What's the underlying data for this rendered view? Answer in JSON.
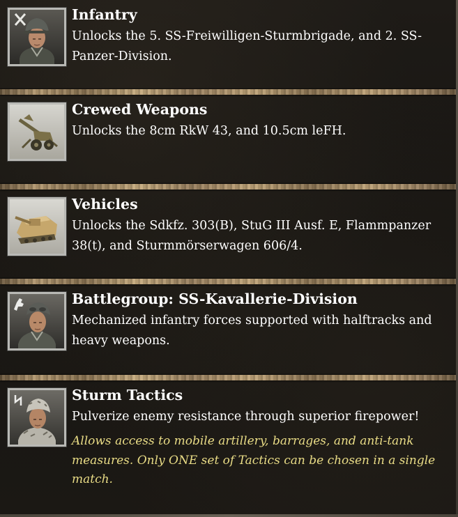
{
  "sections": [
    {
      "title": "Infantry",
      "description": "Unlocks the 5. SS-Freiwilligen-Sturmbrigade, and 2. SS-Panzer-Division.",
      "icon": "soldier-portrait-crossed-swords-icon"
    },
    {
      "title": "Crewed Weapons",
      "description": "Unlocks the 8cm RkW 43, and 10.5cm leFH.",
      "icon": "artillery-gun-icon"
    },
    {
      "title": "Vehicles",
      "description": "Unlocks the Sdkfz. 303(B), StuG III Ausf. E, Flammpanzer 38(t), and Sturmmörserwagen 606/4.",
      "icon": "tank-vehicle-icon"
    },
    {
      "title": "Battlegroup: SS-Kavallerie-Division",
      "description": "Mechanized infantry forces supported with halftracks and heavy weapons.",
      "icon": "soldier-portrait-horse-emblem-icon"
    },
    {
      "title": "Sturm Tactics",
      "description": "Pulverize enemy resistance through superior firepower!",
      "note": "Allows access to mobile artillery, barrages, and anti-tank measures. Only ONE set of Tactics can be chosen in a single match.",
      "icon": "soldier-portrait-rune-emblem-icon"
    }
  ],
  "colors": {
    "title": "#ffffff",
    "description": "#ffffff",
    "note": "#e9dc86",
    "divider": "#b59a72",
    "background": "#1a1713"
  }
}
